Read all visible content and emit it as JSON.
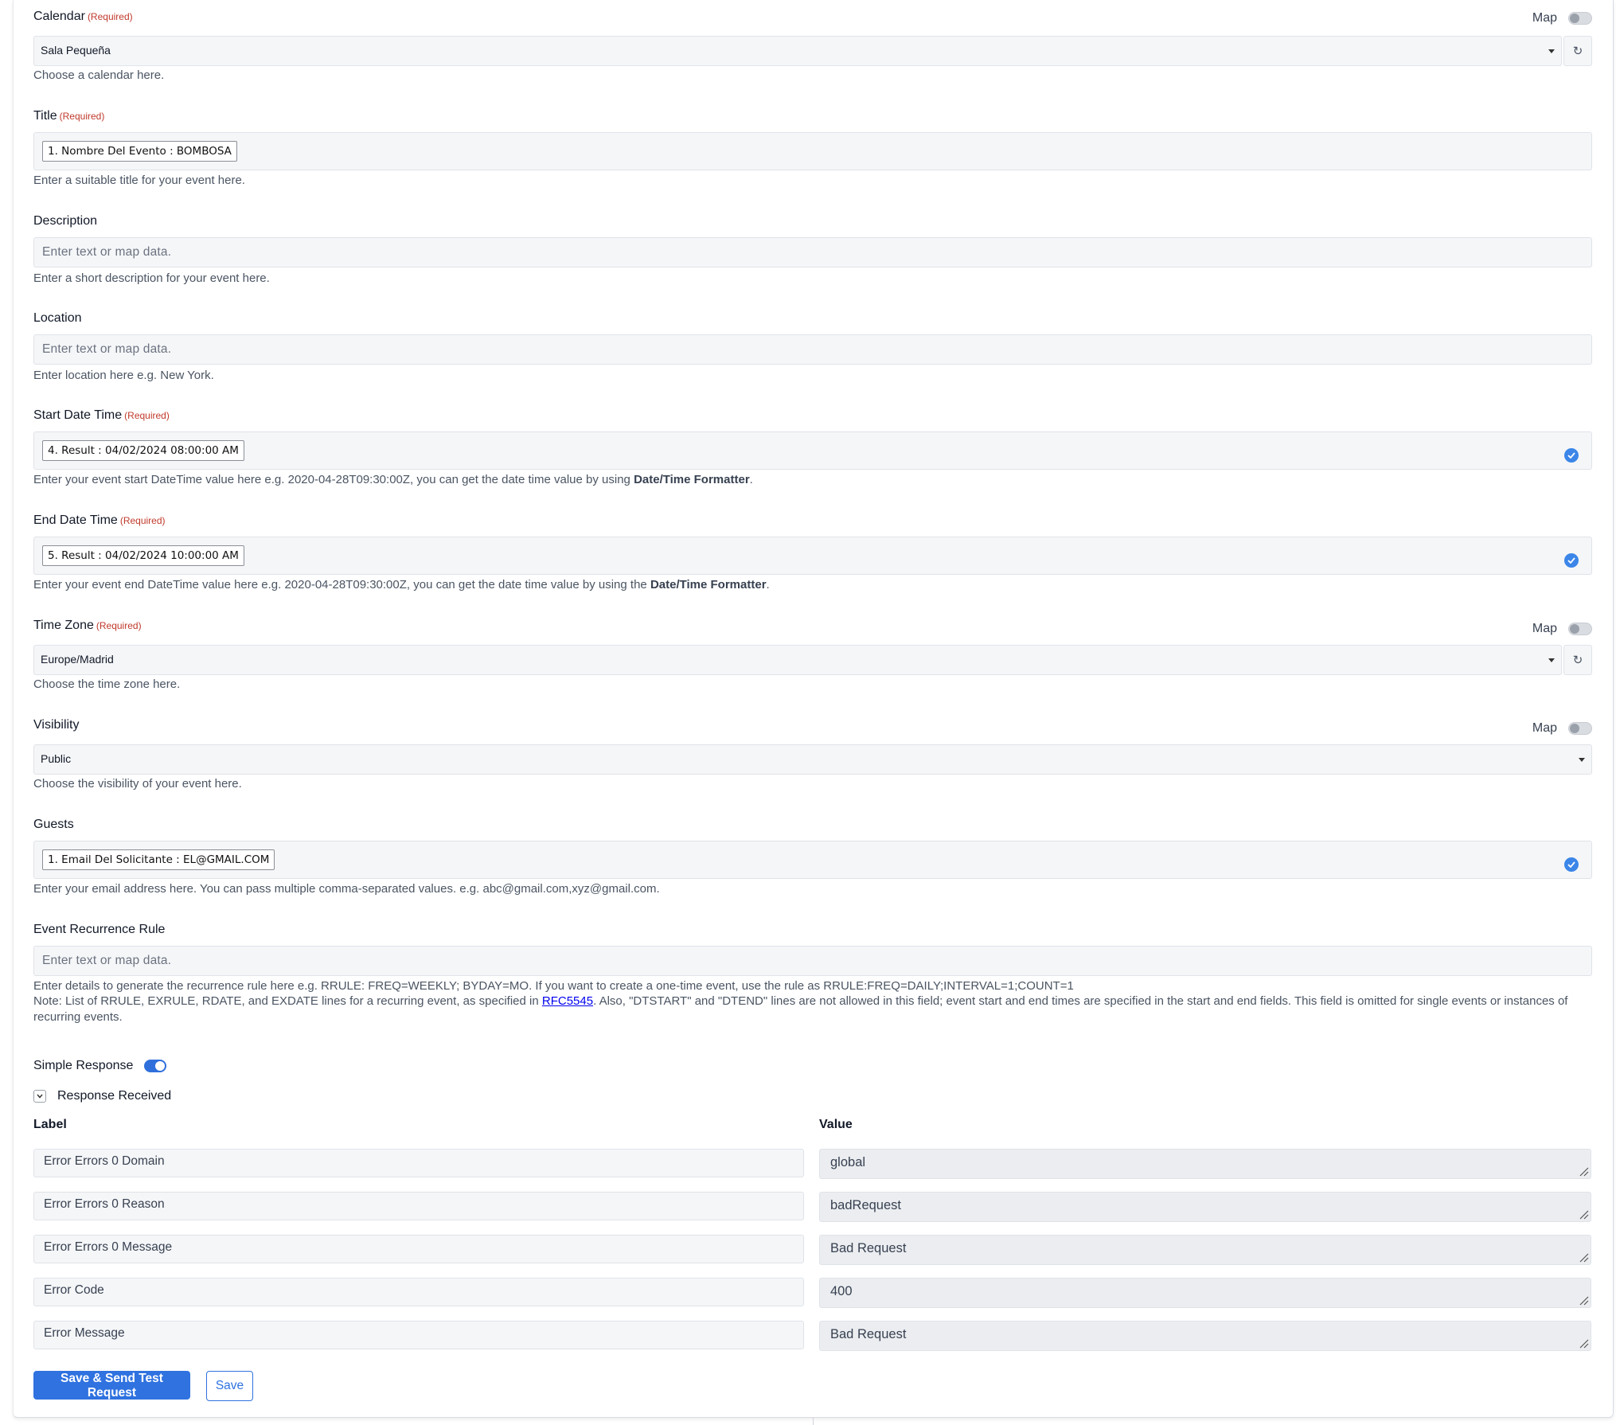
{
  "map_label": "Map",
  "required_label": "(Required)",
  "calendar": {
    "label": "Calendar",
    "value": "Sala Pequeña",
    "help": "Choose a calendar here."
  },
  "title": {
    "label": "Title",
    "token": "1. Nombre Del Evento : BOMBOSA",
    "help": "Enter a suitable title for your event here."
  },
  "description": {
    "label": "Description",
    "placeholder": "Enter text or map data.",
    "help": "Enter a short description for your event here."
  },
  "location": {
    "label": "Location",
    "placeholder": "Enter text or map data.",
    "help": "Enter location here e.g. New York."
  },
  "start": {
    "label": "Start Date Time",
    "token": "4. Result : 04/02/2024 08:00:00 AM",
    "help_prefix": "Enter your event start DateTime value here e.g. 2020-04-28T09:30:00Z, you can get the date time value by using ",
    "help_bold": "Date/Time Formatter",
    "help_suffix": "."
  },
  "end": {
    "label": "End Date Time",
    "token": "5. Result : 04/02/2024 10:00:00 AM",
    "help_prefix": "Enter your event end DateTime value here e.g. 2020-04-28T09:30:00Z, you can get the date time value by using the ",
    "help_bold": "Date/Time Formatter",
    "help_suffix": "."
  },
  "timezone": {
    "label": "Time Zone",
    "value": "Europe/Madrid",
    "help": "Choose the time zone here."
  },
  "visibility": {
    "label": "Visibility",
    "value": "Public",
    "help": "Choose the visibility of your event here."
  },
  "guests": {
    "label": "Guests",
    "token": "1. Email Del Solicitante : EL@GMAIL.COM",
    "help": "Enter your email address here. You can pass multiple comma-separated values. e.g. abc@gmail.com,xyz@gmail.com."
  },
  "recurrence": {
    "label": "Event Recurrence Rule",
    "placeholder": "Enter text or map data.",
    "help": "Enter details to generate the recurrence rule here e.g. RRULE: FREQ=WEEKLY; BYDAY=MO. If you want to create a one-time event, use the rule as RRULE:FREQ=DAILY;INTERVAL=1;COUNT=1",
    "note_prefix": "Note: List of RRULE, EXRULE, RDATE, and EXDATE lines for a recurring event, as specified in ",
    "note_link": "RFC5545",
    "note_suffix": ". Also, \"DTSTART\" and \"DTEND\" lines are not allowed in this field; event start and end times are specified in the start and end fields. This field is omitted for single events or instances of recurring events."
  },
  "simple_response": {
    "label": "Simple Response",
    "enabled": true
  },
  "response_received": {
    "label": "Response Received",
    "col_label": "Label",
    "col_value": "Value",
    "rows": [
      {
        "label": "Error Errors 0 Domain",
        "value": "global"
      },
      {
        "label": "Error Errors 0 Reason",
        "value": "badRequest"
      },
      {
        "label": "Error Errors 0 Message",
        "value": "Bad Request"
      },
      {
        "label": "Error Code",
        "value": "400"
      },
      {
        "label": "Error Message",
        "value": "Bad Request"
      }
    ]
  },
  "buttons": {
    "save_send": "Save & Send Test Request",
    "save": "Save"
  },
  "colors": {
    "primary": "#2f72e0",
    "required": "#c0392b",
    "check": "#3b86e8"
  }
}
